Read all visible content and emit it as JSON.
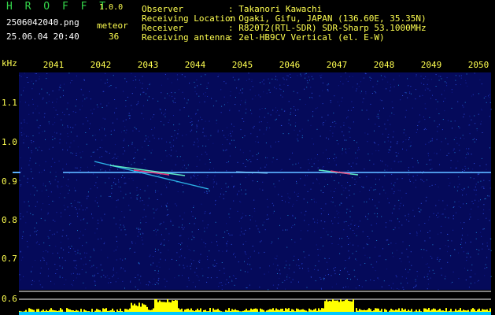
{
  "app": {
    "name": "H R O F F T",
    "version": "1.0.0",
    "filename": "2506042040.png",
    "datetime": "25.06.04 20:40",
    "meteor_label": "meteor",
    "meteor_count": "36"
  },
  "info": {
    "rows": [
      {
        "label": "Observer",
        "value": ": Takanori Kawachi"
      },
      {
        "label": "Receiving Location",
        "value": ": Ogaki, Gifu, JAPAN (136.60E, 35.35N)"
      },
      {
        "label": "Receiver",
        "value": ": R820T2(RTL-SDR) SDR-Sharp 53.1000MHz"
      },
      {
        "label": "Receiving antenna",
        "value": ": 2el-HB9CV Vertical (el. E-W)"
      }
    ]
  },
  "axes": {
    "unit": "kHz",
    "time_ticks": [
      "2041",
      "2042",
      "2043",
      "2044",
      "2045",
      "2046",
      "2047",
      "2048",
      "2049",
      "2050"
    ],
    "freq_ticks": [
      "1.1",
      "1.0",
      "0.9",
      "0.8",
      "0.7",
      "0.6"
    ],
    "freq_ticks_lower": "0.6"
  },
  "colors": {
    "title": "#34d64a",
    "label": "#ffff50",
    "background": "#000000",
    "noise": "#0b0f6e",
    "carrier": "#4aa6ff",
    "level_bar": "#ffff00",
    "level_base": "#00c8ff"
  }
}
